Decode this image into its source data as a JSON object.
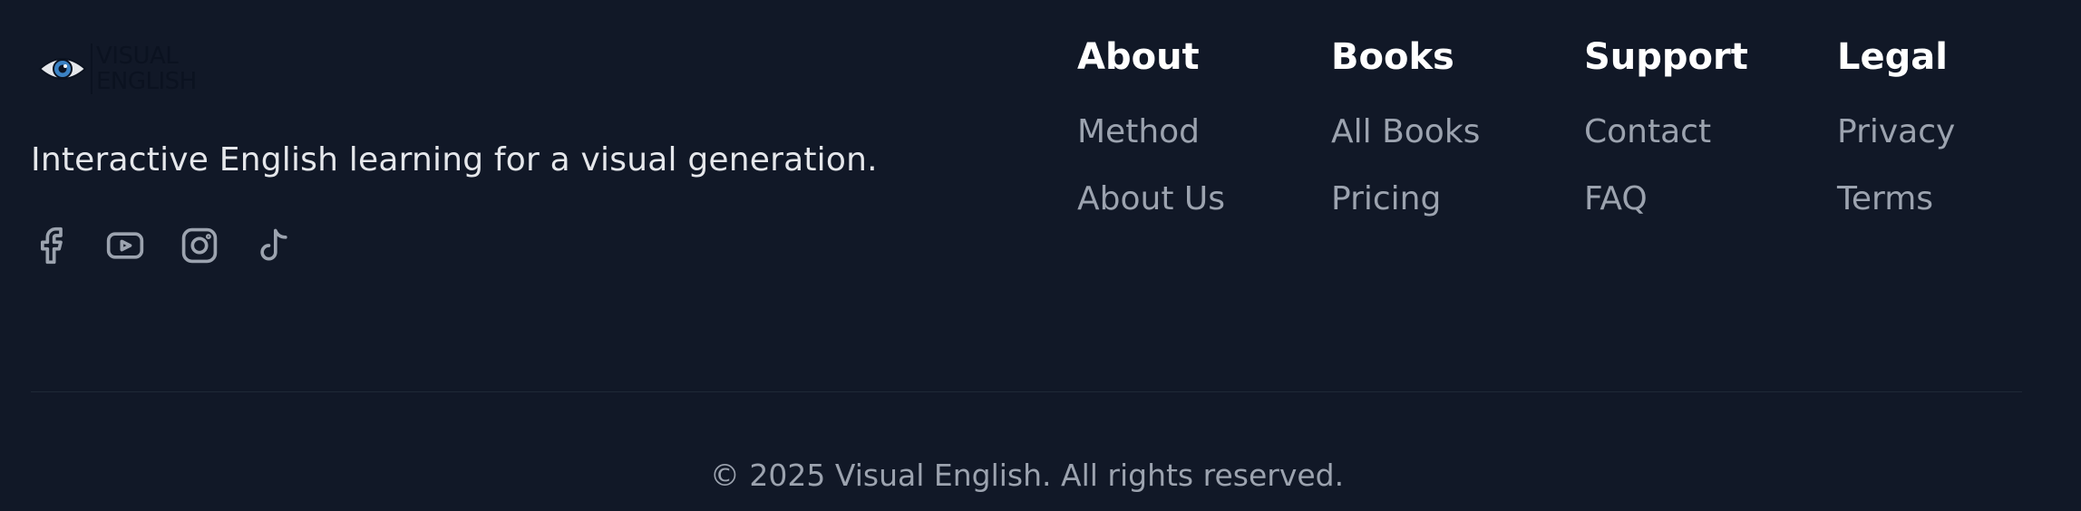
{
  "brand": {
    "logo_line1": "VISUAL",
    "logo_line2": "ENGLISH",
    "tagline": "Interactive English learning for a visual generation.",
    "socials": [
      {
        "icon": "facebook-icon"
      },
      {
        "icon": "youtube-icon"
      },
      {
        "icon": "instagram-icon"
      },
      {
        "icon": "tiktok-icon"
      }
    ]
  },
  "columns": [
    {
      "title": "About",
      "links": [
        "Method",
        "About Us"
      ]
    },
    {
      "title": "Books",
      "links": [
        "All Books",
        "Pricing"
      ]
    },
    {
      "title": "Support",
      "links": [
        "Contact",
        "FAQ"
      ]
    },
    {
      "title": "Legal",
      "links": [
        "Privacy",
        "Terms"
      ]
    }
  ],
  "copyright": "© 2025 Visual English. All rights reserved.",
  "colors": {
    "background": "#111827",
    "heading": "#ffffff",
    "link": "#9ca3af",
    "tagline": "#e5e7eb",
    "divider": "#1f2937"
  }
}
